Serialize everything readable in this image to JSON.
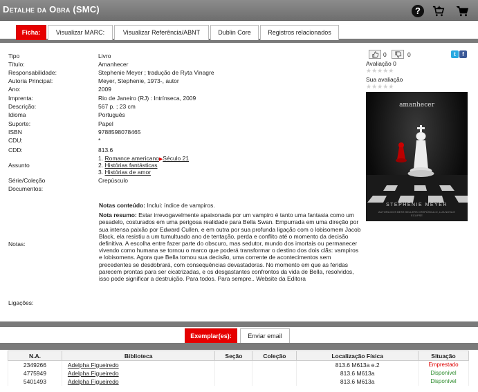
{
  "header": {
    "title": "Detalhe da Obra (SMC)"
  },
  "tabs": [
    {
      "label": "Ficha:",
      "active": true
    },
    {
      "label": "Visualizar MARC:"
    },
    {
      "label": "Visualizar Referência/ABNT"
    },
    {
      "label": "Dublin Core"
    },
    {
      "label": "Registros relacionados"
    }
  ],
  "fields": {
    "tipo": {
      "label": "Tipo",
      "value": "Livro"
    },
    "titulo": {
      "label": "Título:",
      "value": "Amanhecer"
    },
    "responsabilidade": {
      "label": "Responsabilidade:",
      "value": "Stephenie Meyer ; tradução de Ryta Vinagre"
    },
    "autoria": {
      "label": "Autoria Principal:",
      "value": "Meyer, Stephenie, 1973-, autor"
    },
    "ano": {
      "label": "Ano:",
      "value": "2009"
    },
    "imprenta": {
      "label": "Imprenta:",
      "value": "Rio de Janeiro (RJ) : Intrínseca, 2009"
    },
    "descricao": {
      "label": "Descrição:",
      "value": "567 p. ; 23 cm"
    },
    "idioma": {
      "label": "Idioma",
      "value": "Português"
    },
    "suporte": {
      "label": "Suporte:",
      "value": "Papel"
    },
    "isbn": {
      "label": "ISBN",
      "value": "9788598078465"
    },
    "cdu": {
      "label": "CDU:",
      "value": "*"
    },
    "cdd": {
      "label": "CDD:",
      "value": "813.6"
    },
    "assunto": {
      "label": "Assunto",
      "line1_num": "1.",
      "line1_a": "Romance americano",
      "line1_b": "Século 21",
      "line2_num": "2.",
      "line2": "Histórias fantásticas",
      "line3_num": "3.",
      "line3": "Histórias de amor"
    },
    "serie": {
      "label": "Série/Coleção",
      "value": "Crepúsculo"
    },
    "documentos": {
      "label": "Documentos:"
    },
    "notas": {
      "label": "Notas:",
      "conteudo_label": "Notas conteúdo:",
      "conteudo": "Inclui: índice de vampiros.",
      "resumo_label": "Nota resumo:",
      "resumo": "Estar irrevogavelmente apaixonada por um vampiro é tanto uma fantasia como um pesadelo, costurados em uma perigosa realidade para Bella Swan. Empurrada em uma direção por sua intensa paixão por Edward Cullen, e em outra por sua profunda ligação com o lobisomem Jacob Black, ela resistiu a um tumultuado ano de tentação, perda e conflito até o momento da decisão definitiva. A escolha entre fazer parte do obscuro, mas sedutor, mundo dos imortais ou permanecer vivendo como humana se tornou o marco que poderá transformar o destino dos dois clãs: vampiros e lobisomens. Agora que Bella tomou sua decisão, uma corrente de acontecimentos sem precedentes se desdobrará, com consequências devastadoras. No momento em que as feridas parecem prontas para ser cicatrizadas, e os desgastantes confrontos da vida de Bella, resolvidos, isso pode significar a destruição. Para todos. Para sempre.. Website da Editora"
    },
    "ligacoes": {
      "label": "Ligações:"
    }
  },
  "rating": {
    "likes": "0",
    "dislikes": "0",
    "avaliacao_label": "Avaliação 0",
    "sua_avaliacao_label": "Sua avaliação",
    "stars": "★★★★★"
  },
  "cover": {
    "title": "amanhecer",
    "author": "STEPHENIE MEYER",
    "subtitle": "AUTORA DOS BEST-SELLERS CREPÚSCULO, LUA NOVA E ECLIPSE"
  },
  "exemplares": {
    "tab_label": "Exemplar(es):",
    "email_label": "Enviar email",
    "columns": [
      "N.A.",
      "Biblioteca",
      "Seção",
      "Coleção",
      "Localização Física",
      "Situação"
    ],
    "rows": [
      {
        "na": "2349266",
        "biblioteca": "Adelpha Figueiredo",
        "secao": "",
        "colecao": "",
        "localizacao": "813.6 M613a e.2",
        "situacao": "Emprestado"
      },
      {
        "na": "4775949",
        "biblioteca": "Adelpha Figueiredo",
        "secao": "",
        "colecao": "",
        "localizacao": "813.6 M613a",
        "situacao": "Disponível"
      },
      {
        "na": "5401493",
        "biblioteca": "Adelpha Figueiredo",
        "secao": "",
        "colecao": "",
        "localizacao": "813.6 M613a",
        "situacao": "Disponível"
      }
    ]
  },
  "colors": {
    "accent": "#e60000",
    "bar": "#7a7a7a",
    "available": "#2a8a2a",
    "loaned": "#d00000"
  }
}
